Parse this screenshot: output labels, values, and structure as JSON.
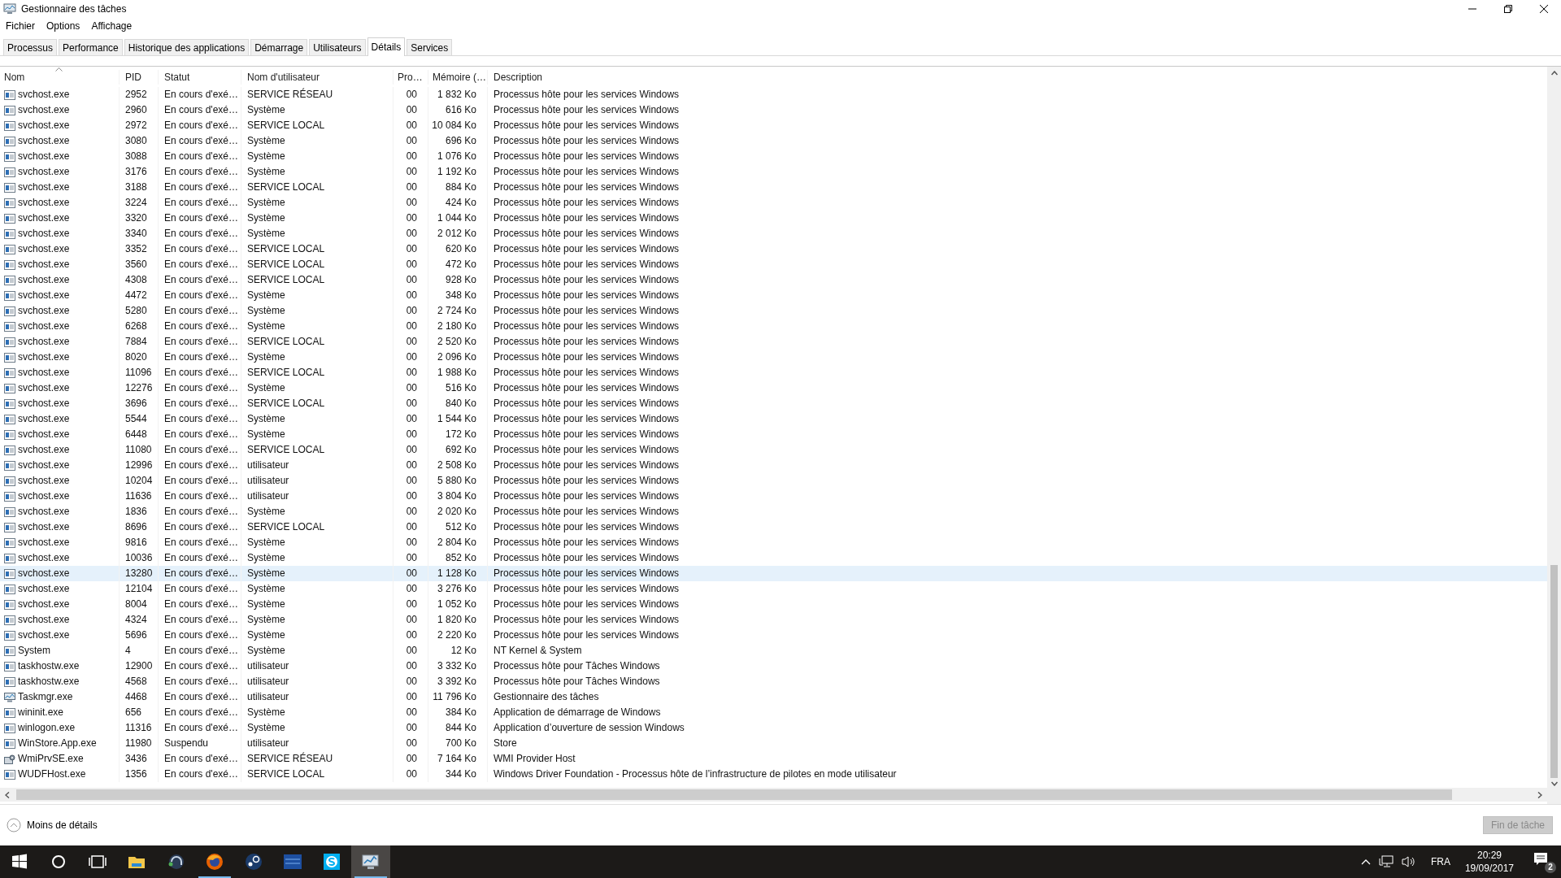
{
  "window": {
    "title": "Gestionnaire des tâches"
  },
  "menu": [
    "Fichier",
    "Options",
    "Affichage"
  ],
  "tabs": [
    {
      "label": "Processus",
      "selected": false
    },
    {
      "label": "Performance",
      "selected": false
    },
    {
      "label": "Historique des applications",
      "selected": false
    },
    {
      "label": "Démarrage",
      "selected": false
    },
    {
      "label": "Utilisateurs",
      "selected": false
    },
    {
      "label": "Détails",
      "selected": true
    },
    {
      "label": "Services",
      "selected": false
    }
  ],
  "table": {
    "columns": [
      "Nom",
      "PID",
      "Statut",
      "Nom d'utilisateur",
      "Pro…",
      "Mémoire (…",
      "Description"
    ],
    "rows": [
      {
        "kind": "service",
        "name": "svchost.exe",
        "pid": "2952",
        "status": "En cours d'exé…",
        "user": "SERVICE RÉSEAU",
        "cpu": "00",
        "memory": "1 832 Ko",
        "description": "Processus hôte pour les services Windows",
        "selected": false
      },
      {
        "kind": "service",
        "name": "svchost.exe",
        "pid": "2960",
        "status": "En cours d'exé…",
        "user": "Système",
        "cpu": "00",
        "memory": "616 Ko",
        "description": "Processus hôte pour les services Windows",
        "selected": false
      },
      {
        "kind": "service",
        "name": "svchost.exe",
        "pid": "2972",
        "status": "En cours d'exé…",
        "user": "SERVICE LOCAL",
        "cpu": "00",
        "memory": "10 084 Ko",
        "description": "Processus hôte pour les services Windows",
        "selected": false
      },
      {
        "kind": "service",
        "name": "svchost.exe",
        "pid": "3080",
        "status": "En cours d'exé…",
        "user": "Système",
        "cpu": "00",
        "memory": "696 Ko",
        "description": "Processus hôte pour les services Windows",
        "selected": false
      },
      {
        "kind": "service",
        "name": "svchost.exe",
        "pid": "3088",
        "status": "En cours d'exé…",
        "user": "Système",
        "cpu": "00",
        "memory": "1 076 Ko",
        "description": "Processus hôte pour les services Windows",
        "selected": false
      },
      {
        "kind": "service",
        "name": "svchost.exe",
        "pid": "3176",
        "status": "En cours d'exé…",
        "user": "Système",
        "cpu": "00",
        "memory": "1 192 Ko",
        "description": "Processus hôte pour les services Windows",
        "selected": false
      },
      {
        "kind": "service",
        "name": "svchost.exe",
        "pid": "3188",
        "status": "En cours d'exé…",
        "user": "SERVICE LOCAL",
        "cpu": "00",
        "memory": "884 Ko",
        "description": "Processus hôte pour les services Windows",
        "selected": false
      },
      {
        "kind": "service",
        "name": "svchost.exe",
        "pid": "3224",
        "status": "En cours d'exé…",
        "user": "Système",
        "cpu": "00",
        "memory": "424 Ko",
        "description": "Processus hôte pour les services Windows",
        "selected": false
      },
      {
        "kind": "service",
        "name": "svchost.exe",
        "pid": "3320",
        "status": "En cours d'exé…",
        "user": "Système",
        "cpu": "00",
        "memory": "1 044 Ko",
        "description": "Processus hôte pour les services Windows",
        "selected": false
      },
      {
        "kind": "service",
        "name": "svchost.exe",
        "pid": "3340",
        "status": "En cours d'exé…",
        "user": "Système",
        "cpu": "00",
        "memory": "2 012 Ko",
        "description": "Processus hôte pour les services Windows",
        "selected": false
      },
      {
        "kind": "service",
        "name": "svchost.exe",
        "pid": "3352",
        "status": "En cours d'exé…",
        "user": "SERVICE LOCAL",
        "cpu": "00",
        "memory": "620 Ko",
        "description": "Processus hôte pour les services Windows",
        "selected": false
      },
      {
        "kind": "service",
        "name": "svchost.exe",
        "pid": "3560",
        "status": "En cours d'exé…",
        "user": "SERVICE LOCAL",
        "cpu": "00",
        "memory": "472 Ko",
        "description": "Processus hôte pour les services Windows",
        "selected": false
      },
      {
        "kind": "service",
        "name": "svchost.exe",
        "pid": "4308",
        "status": "En cours d'exé…",
        "user": "SERVICE LOCAL",
        "cpu": "00",
        "memory": "928 Ko",
        "description": "Processus hôte pour les services Windows",
        "selected": false
      },
      {
        "kind": "service",
        "name": "svchost.exe",
        "pid": "4472",
        "status": "En cours d'exé…",
        "user": "Système",
        "cpu": "00",
        "memory": "348 Ko",
        "description": "Processus hôte pour les services Windows",
        "selected": false
      },
      {
        "kind": "service",
        "name": "svchost.exe",
        "pid": "5280",
        "status": "En cours d'exé…",
        "user": "Système",
        "cpu": "00",
        "memory": "2 724 Ko",
        "description": "Processus hôte pour les services Windows",
        "selected": false
      },
      {
        "kind": "service",
        "name": "svchost.exe",
        "pid": "6268",
        "status": "En cours d'exé…",
        "user": "Système",
        "cpu": "00",
        "memory": "2 180 Ko",
        "description": "Processus hôte pour les services Windows",
        "selected": false
      },
      {
        "kind": "service",
        "name": "svchost.exe",
        "pid": "7884",
        "status": "En cours d'exé…",
        "user": "SERVICE LOCAL",
        "cpu": "00",
        "memory": "2 520 Ko",
        "description": "Processus hôte pour les services Windows",
        "selected": false
      },
      {
        "kind": "service",
        "name": "svchost.exe",
        "pid": "8020",
        "status": "En cours d'exé…",
        "user": "Système",
        "cpu": "00",
        "memory": "2 096 Ko",
        "description": "Processus hôte pour les services Windows",
        "selected": false
      },
      {
        "kind": "service",
        "name": "svchost.exe",
        "pid": "11096",
        "status": "En cours d'exé…",
        "user": "SERVICE LOCAL",
        "cpu": "00",
        "memory": "1 988 Ko",
        "description": "Processus hôte pour les services Windows",
        "selected": false
      },
      {
        "kind": "service",
        "name": "svchost.exe",
        "pid": "12276",
        "status": "En cours d'exé…",
        "user": "Système",
        "cpu": "00",
        "memory": "516 Ko",
        "description": "Processus hôte pour les services Windows",
        "selected": false
      },
      {
        "kind": "service",
        "name": "svchost.exe",
        "pid": "3696",
        "status": "En cours d'exé…",
        "user": "SERVICE LOCAL",
        "cpu": "00",
        "memory": "840 Ko",
        "description": "Processus hôte pour les services Windows",
        "selected": false
      },
      {
        "kind": "service",
        "name": "svchost.exe",
        "pid": "5544",
        "status": "En cours d'exé…",
        "user": "Système",
        "cpu": "00",
        "memory": "1 544 Ko",
        "description": "Processus hôte pour les services Windows",
        "selected": false
      },
      {
        "kind": "service",
        "name": "svchost.exe",
        "pid": "6448",
        "status": "En cours d'exé…",
        "user": "Système",
        "cpu": "00",
        "memory": "172 Ko",
        "description": "Processus hôte pour les services Windows",
        "selected": false
      },
      {
        "kind": "service",
        "name": "svchost.exe",
        "pid": "11080",
        "status": "En cours d'exé…",
        "user": "SERVICE LOCAL",
        "cpu": "00",
        "memory": "692 Ko",
        "description": "Processus hôte pour les services Windows",
        "selected": false
      },
      {
        "kind": "service",
        "name": "svchost.exe",
        "pid": "12996",
        "status": "En cours d'exé…",
        "user": "utilisateur",
        "cpu": "00",
        "memory": "2 508 Ko",
        "description": "Processus hôte pour les services Windows",
        "selected": false
      },
      {
        "kind": "service",
        "name": "svchost.exe",
        "pid": "10204",
        "status": "En cours d'exé…",
        "user": "utilisateur",
        "cpu": "00",
        "memory": "5 880 Ko",
        "description": "Processus hôte pour les services Windows",
        "selected": false
      },
      {
        "kind": "service",
        "name": "svchost.exe",
        "pid": "11636",
        "status": "En cours d'exé…",
        "user": "utilisateur",
        "cpu": "00",
        "memory": "3 804 Ko",
        "description": "Processus hôte pour les services Windows",
        "selected": false
      },
      {
        "kind": "service",
        "name": "svchost.exe",
        "pid": "1836",
        "status": "En cours d'exé…",
        "user": "Système",
        "cpu": "00",
        "memory": "2 020 Ko",
        "description": "Processus hôte pour les services Windows",
        "selected": false
      },
      {
        "kind": "service",
        "name": "svchost.exe",
        "pid": "8696",
        "status": "En cours d'exé…",
        "user": "SERVICE LOCAL",
        "cpu": "00",
        "memory": "512 Ko",
        "description": "Processus hôte pour les services Windows",
        "selected": false
      },
      {
        "kind": "service",
        "name": "svchost.exe",
        "pid": "9816",
        "status": "En cours d'exé…",
        "user": "Système",
        "cpu": "00",
        "memory": "2 804 Ko",
        "description": "Processus hôte pour les services Windows",
        "selected": false
      },
      {
        "kind": "service",
        "name": "svchost.exe",
        "pid": "10036",
        "status": "En cours d'exé…",
        "user": "Système",
        "cpu": "00",
        "memory": "852 Ko",
        "description": "Processus hôte pour les services Windows",
        "selected": false
      },
      {
        "kind": "service",
        "name": "svchost.exe",
        "pid": "13280",
        "status": "En cours d'exé…",
        "user": "Système",
        "cpu": "00",
        "memory": "1 128 Ko",
        "description": "Processus hôte pour les services Windows",
        "selected": true
      },
      {
        "kind": "service",
        "name": "svchost.exe",
        "pid": "12104",
        "status": "En cours d'exé…",
        "user": "Système",
        "cpu": "00",
        "memory": "3 276 Ko",
        "description": "Processus hôte pour les services Windows",
        "selected": false
      },
      {
        "kind": "service",
        "name": "svchost.exe",
        "pid": "8004",
        "status": "En cours d'exé…",
        "user": "Système",
        "cpu": "00",
        "memory": "1 052 Ko",
        "description": "Processus hôte pour les services Windows",
        "selected": false
      },
      {
        "kind": "service",
        "name": "svchost.exe",
        "pid": "4324",
        "status": "En cours d'exé…",
        "user": "Système",
        "cpu": "00",
        "memory": "1 820 Ko",
        "description": "Processus hôte pour les services Windows",
        "selected": false
      },
      {
        "kind": "service",
        "name": "svchost.exe",
        "pid": "5696",
        "status": "En cours d'exé…",
        "user": "Système",
        "cpu": "00",
        "memory": "2 220 Ko",
        "description": "Processus hôte pour les services Windows",
        "selected": false
      },
      {
        "kind": "service",
        "name": "System",
        "pid": "4",
        "status": "En cours d'exé…",
        "user": "Système",
        "cpu": "00",
        "memory": "12 Ko",
        "description": "NT Kernel & System",
        "selected": false
      },
      {
        "kind": "service",
        "name": "taskhostw.exe",
        "pid": "12900",
        "status": "En cours d'exé…",
        "user": "utilisateur",
        "cpu": "00",
        "memory": "3 332 Ko",
        "description": "Processus hôte pour Tâches Windows",
        "selected": false
      },
      {
        "kind": "service",
        "name": "taskhostw.exe",
        "pid": "4568",
        "status": "En cours d'exé…",
        "user": "utilisateur",
        "cpu": "00",
        "memory": "3 392 Ko",
        "description": "Processus hôte pour Tâches Windows",
        "selected": false
      },
      {
        "kind": "monitor",
        "name": "Taskmgr.exe",
        "pid": "4468",
        "status": "En cours d'exé…",
        "user": "utilisateur",
        "cpu": "00",
        "memory": "11 796 Ko",
        "description": "Gestionnaire des tâches",
        "selected": false
      },
      {
        "kind": "service",
        "name": "wininit.exe",
        "pid": "656",
        "status": "En cours d'exé…",
        "user": "Système",
        "cpu": "00",
        "memory": "384 Ko",
        "description": "Application de démarrage de Windows",
        "selected": false
      },
      {
        "kind": "service",
        "name": "winlogon.exe",
        "pid": "11316",
        "status": "En cours d'exé…",
        "user": "Système",
        "cpu": "00",
        "memory": "844 Ko",
        "description": "Application d’ouverture de session Windows",
        "selected": false
      },
      {
        "kind": "service",
        "name": "WinStore.App.exe",
        "pid": "11980",
        "status": "Suspendu",
        "user": "utilisateur",
        "cpu": "00",
        "memory": "700 Ko",
        "description": "Store",
        "selected": false
      },
      {
        "kind": "gear",
        "name": "WmiPrvSE.exe",
        "pid": "3436",
        "status": "En cours d'exé…",
        "user": "SERVICE RÉSEAU",
        "cpu": "00",
        "memory": "7 164 Ko",
        "description": "WMI Provider Host",
        "selected": false
      },
      {
        "kind": "service",
        "name": "WUDFHost.exe",
        "pid": "1356",
        "status": "En cours d'exé…",
        "user": "SERVICE LOCAL",
        "cpu": "00",
        "memory": "344 Ko",
        "description": "Windows Driver Foundation - Processus hôte de l’infrastructure de pilotes en mode utilisateur",
        "selected": false
      }
    ]
  },
  "footer": {
    "toggle": "Moins de détails",
    "end_task": {
      "label": "Fin de tâche",
      "disabled": true
    }
  },
  "taskbar": {
    "apps": [
      {
        "kind": "start",
        "running": false,
        "selected": false
      },
      {
        "kind": "search",
        "running": false,
        "selected": false
      },
      {
        "kind": "taskview",
        "running": false,
        "selected": false
      },
      {
        "kind": "folder",
        "running": false,
        "selected": false
      },
      {
        "kind": "headset",
        "running": false,
        "selected": false
      },
      {
        "kind": "browser",
        "running": true,
        "selected": false
      },
      {
        "kind": "disc",
        "running": false,
        "selected": false
      },
      {
        "kind": "tile",
        "running": false,
        "selected": false
      },
      {
        "kind": "chat",
        "running": false,
        "selected": false
      },
      {
        "kind": "monitor",
        "running": true,
        "selected": true
      }
    ],
    "language": "FRA",
    "time": "20:29",
    "date": "19/09/2017",
    "notifications": "2"
  }
}
